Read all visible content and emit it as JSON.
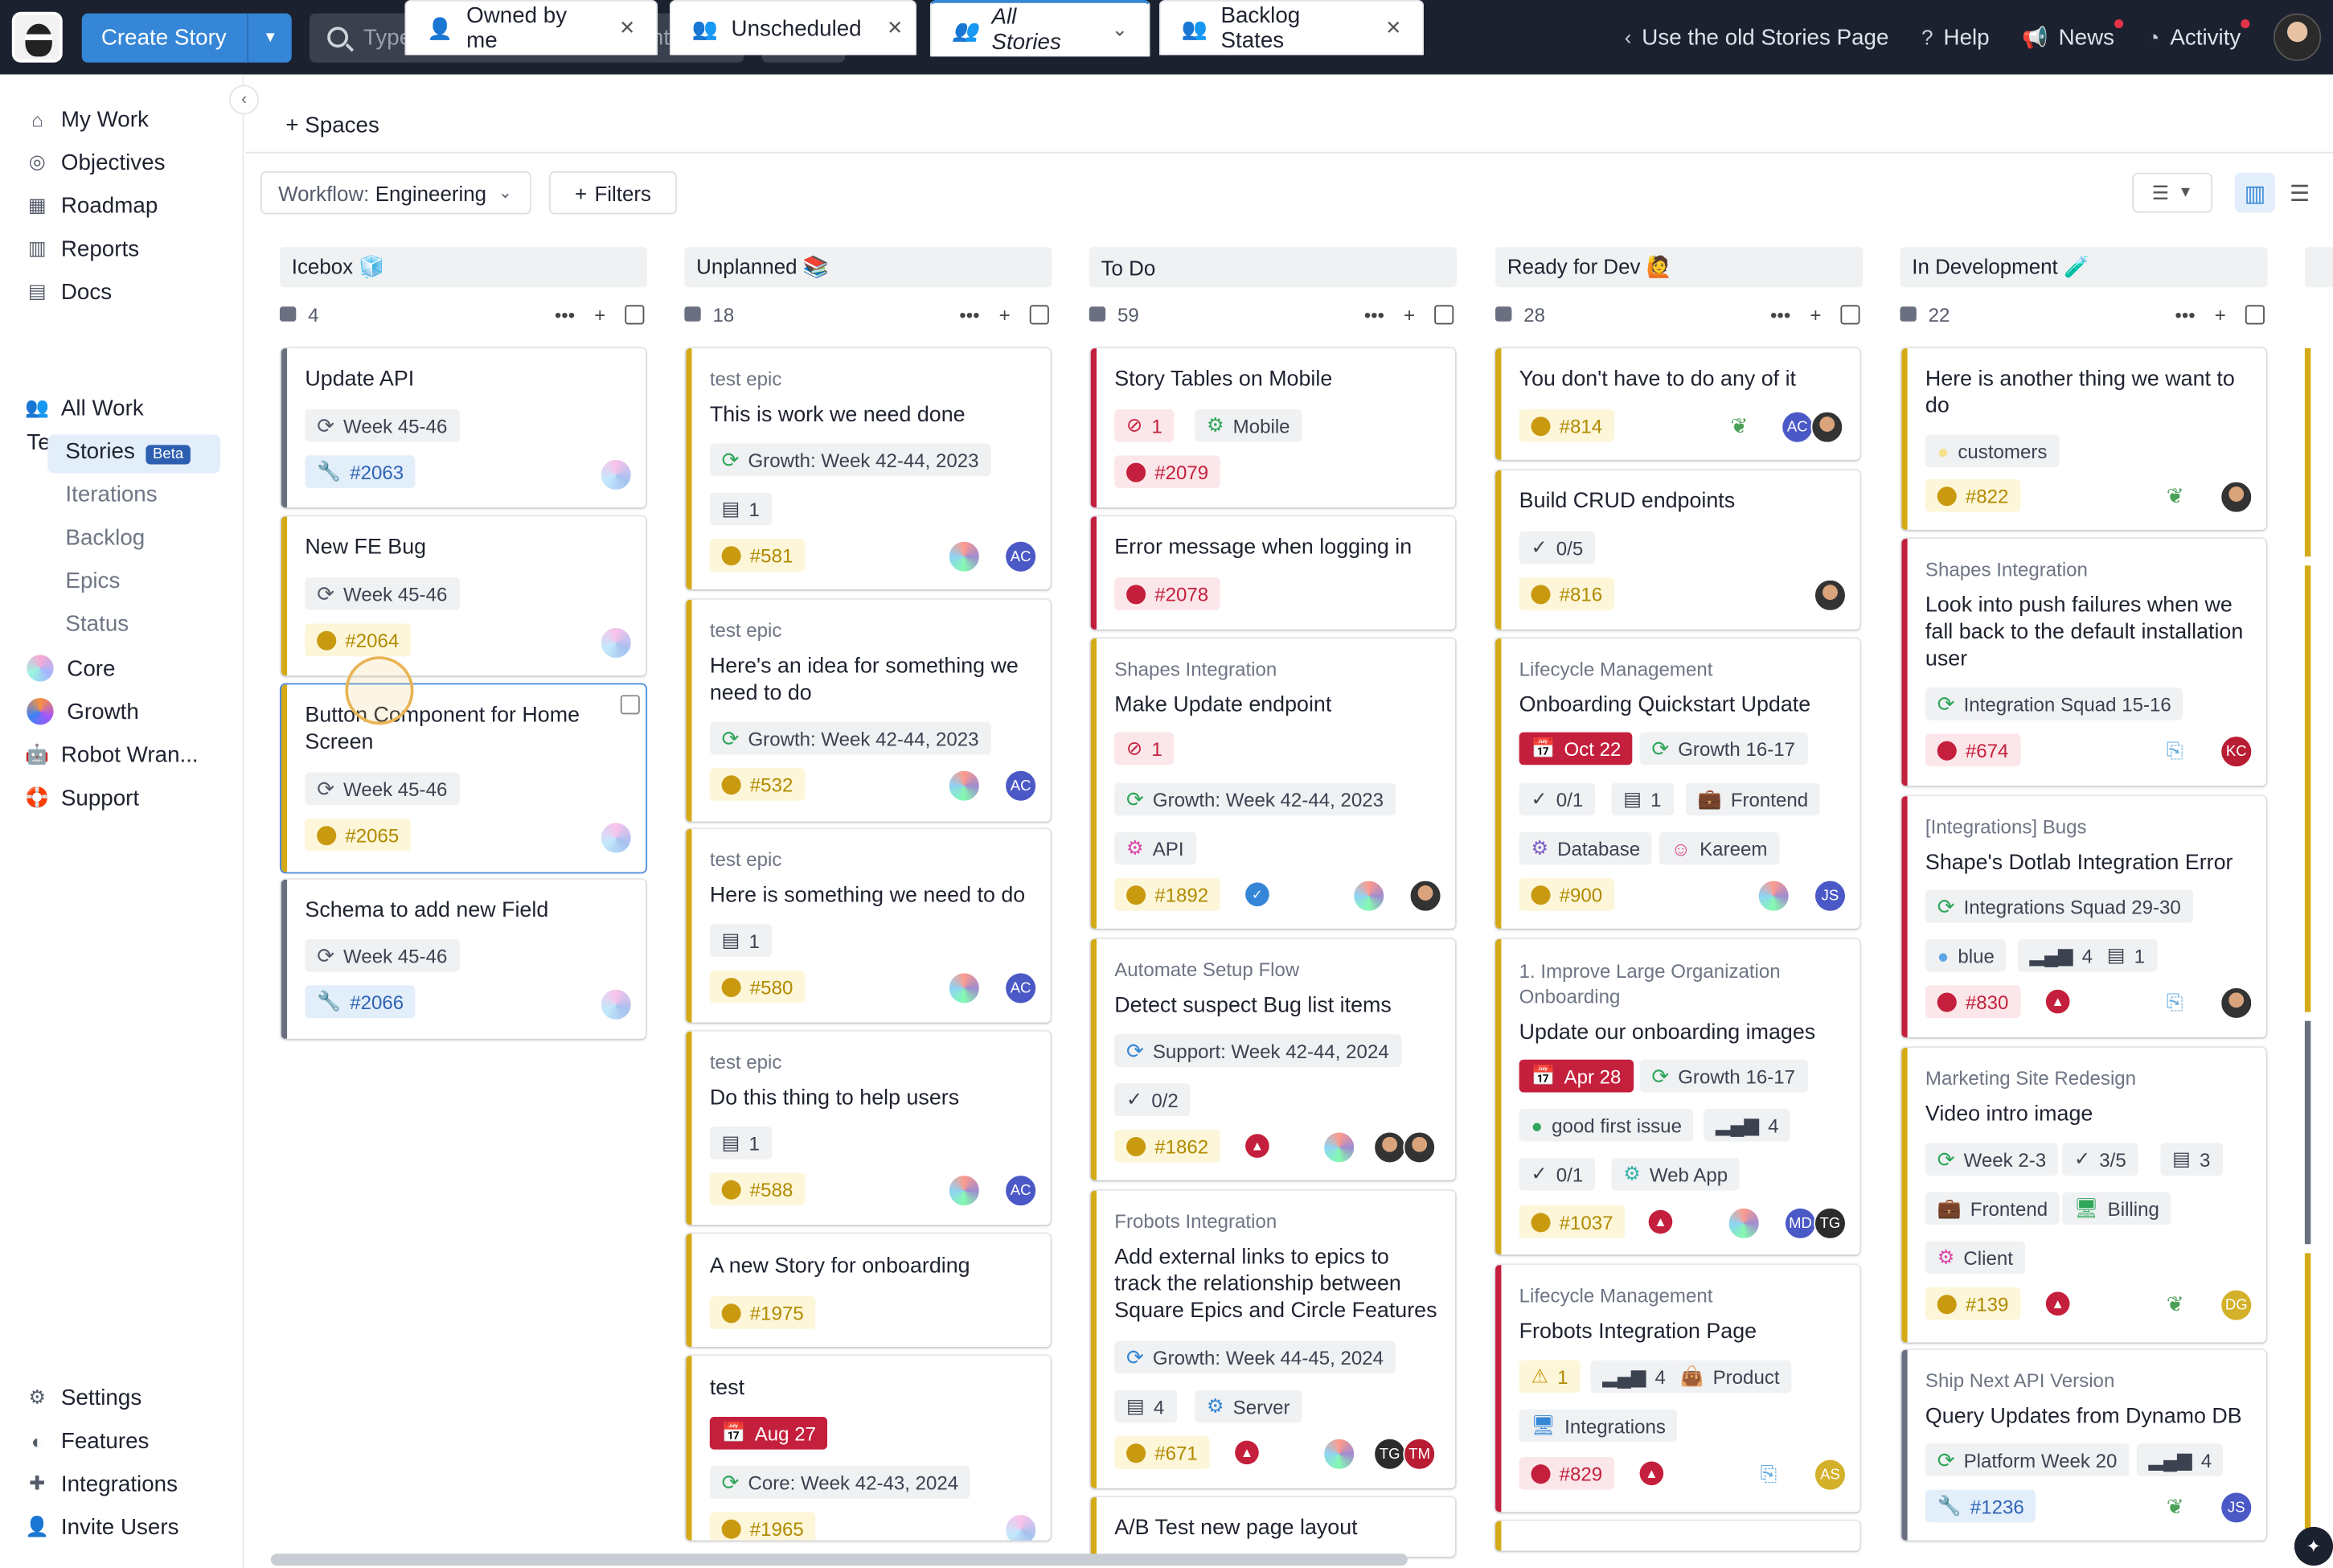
{
  "topbar": {
    "create_story": "Create Story",
    "search_placeholder": "Type",
    "search_slash": "/",
    "search_hint": "for search and recents...",
    "cmdk": "⌘ K",
    "old_stories": "Use the old Stories Page",
    "help": "Help",
    "news": "News",
    "activity": "Activity"
  },
  "sidebar": {
    "nav": [
      "My Work",
      "Objectives",
      "Roadmap",
      "Reports",
      "Docs"
    ],
    "teams_title": "Teams",
    "all_work": "All Work",
    "stories": "Stories",
    "beta": "Beta",
    "sub": [
      "Iterations",
      "Backlog",
      "Epics",
      "Status"
    ],
    "teams": [
      "Core",
      "Growth",
      "Robot Wran...",
      "Support"
    ],
    "bottom": [
      "Settings",
      "Features",
      "Integrations",
      "Invite Users"
    ]
  },
  "tabs": {
    "add_spaces": "+ Spaces",
    "items": [
      "Owned by me",
      "Unscheduled",
      "All Stories",
      "Backlog States"
    ]
  },
  "filters": {
    "workflow_label": "Workflow:",
    "workflow_value": "Engineering",
    "filters": "Filters"
  },
  "columns": [
    {
      "name": "Icebox 🧊",
      "count": "4"
    },
    {
      "name": "Unplanned 📚",
      "count": "18"
    },
    {
      "name": "To Do",
      "count": "59"
    },
    {
      "name": "Ready for Dev 🙋",
      "count": "28"
    },
    {
      "name": "In Development 🧪",
      "count": "22"
    }
  ],
  "icebox": [
    {
      "title": "Update API",
      "iter": "Week 45-46",
      "id": "#2063"
    },
    {
      "title": "New FE Bug",
      "iter": "Week 45-46",
      "id": "#2064"
    },
    {
      "title": "Button Component for Home Screen",
      "iter": "Week 45-46",
      "id": "#2065"
    },
    {
      "title": "Schema to add new Field",
      "iter": "Week 45-46",
      "id": "#2066"
    }
  ],
  "unplanned": [
    {
      "epic": "test epic",
      "title": "This is work we need done",
      "iter": "Growth: Week 42-44, 2023",
      "docs": "1",
      "id": "#581",
      "av": "AC"
    },
    {
      "epic": "test epic",
      "title": "Here's an idea for something we need to do",
      "iter": "Growth: Week 42-44, 2023",
      "id": "#532",
      "av": "AC"
    },
    {
      "epic": "test epic",
      "title": "Here is something we need to do",
      "docs": "1",
      "id": "#580",
      "av": "AC"
    },
    {
      "epic": "test epic",
      "title": "Do this thing to help users",
      "docs": "1",
      "id": "#588",
      "av": "AC"
    },
    {
      "title": "A new Story for onboarding",
      "id": "#1975"
    },
    {
      "title": "test",
      "date": "Aug 27",
      "iter": "Core: Week 42-43, 2024",
      "id": "#1965"
    }
  ],
  "todo": [
    {
      "title": "Story Tables on Mobile",
      "blocked": "1",
      "label": "Mobile",
      "id": "#2079"
    },
    {
      "title": "Error message when logging in",
      "id": "#2078"
    },
    {
      "epic": "Shapes Integration",
      "title": "Make Update endpoint",
      "blocked": "1",
      "iter": "Growth: Week 42-44, 2023",
      "label": "API",
      "id": "#1892"
    },
    {
      "epic": "Automate Setup Flow",
      "title": "Detect suspect Bug list items",
      "iter": "Support: Week 42-44, 2024",
      "tasks": "0/2",
      "id": "#1862"
    },
    {
      "epic": "Frobots Integration",
      "title": "Add external links to epics to track the relationship between Square Epics and Circle Features",
      "iter": "Growth: Week 44-45, 2024",
      "docs": "4",
      "label": "Server",
      "id": "#671",
      "av1": "TG",
      "av2": "TM"
    },
    {
      "title": "A/B Test new page layout"
    }
  ],
  "ready": [
    {
      "title": "You don't have to do any of it",
      "id": "#814",
      "av": "AC"
    },
    {
      "title": "Build CRUD endpoints",
      "tasks": "0/5",
      "id": "#816"
    },
    {
      "epic": "Lifecycle Management",
      "title": "Onboarding Quickstart Update",
      "date": "Oct 22",
      "iter": "Growth 16-17",
      "tasks": "0/1",
      "docs": "1",
      "label1": "Frontend",
      "label2": "Database",
      "label3": "Kareem",
      "id": "#900",
      "av": "JS"
    },
    {
      "epic": "1. Improve Large Organization Onboarding",
      "title": "Update our onboarding images",
      "date": "Apr 28",
      "iter": "Growth 16-17",
      "label1": "good first issue",
      "est": "4",
      "tasks": "0/1",
      "label2": "Web App",
      "id": "#1037",
      "av1": "MD",
      "av2": "TG"
    },
    {
      "epic": "Lifecycle Management",
      "title": "Frobots Integration Page",
      "warn": "1",
      "est": "4",
      "label1": "Product",
      "label2": "Integrations",
      "id": "#829",
      "av": "AS"
    }
  ],
  "indev": [
    {
      "title": "Here is another thing we want to do",
      "label": "customers",
      "id": "#822"
    },
    {
      "epic": "Shapes Integration",
      "title": "Look into push failures when we fall back to the default installation user",
      "iter": "Integration Squad 15-16",
      "id": "#674",
      "av": "KC"
    },
    {
      "epic": "[Integrations] Bugs",
      "title": "Shape's Dotlab Integration Error",
      "iter": "Integrations Squad 29-30",
      "label": "blue",
      "est": "4",
      "docs": "1",
      "id": "#830"
    },
    {
      "epic": "Marketing Site Redesign",
      "title": "Video intro image",
      "iter": "Week 2-3",
      "tasks": "3/5",
      "docs": "3",
      "label1": "Frontend",
      "label2": "Billing",
      "label3": "Client",
      "id": "#139",
      "av": "DG"
    },
    {
      "epic": "Ship Next API Version",
      "title": "Query Updates from Dynamo DB",
      "iter": "Platform Week 20",
      "est": "4",
      "id": "#1236",
      "av": "JS"
    }
  ],
  "colors": {
    "accent": "#3586d6",
    "topbar": "#1c2130",
    "feature": "#d4aa16",
    "bug": "#c41f3c",
    "chore": "#6a7080"
  }
}
